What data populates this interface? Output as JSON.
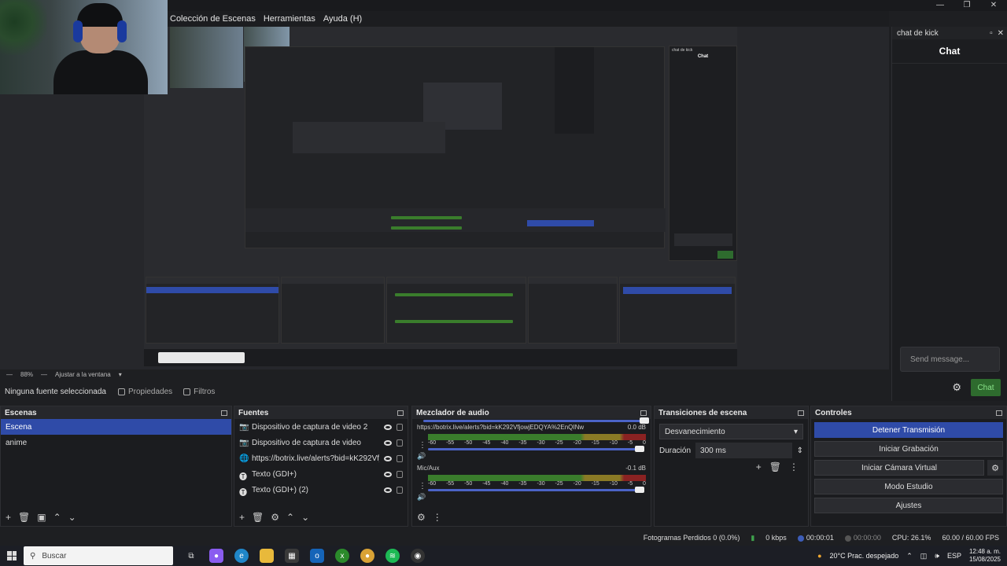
{
  "window": {
    "controls": [
      "—",
      "❐",
      "✕"
    ]
  },
  "menu": {
    "items": [
      "Colección de Escenas",
      "Herramientas",
      "Ayuda (H)"
    ]
  },
  "zoom": {
    "level": "88%",
    "fit": "Ajustar a la ventana"
  },
  "source_bar": {
    "selection": "Ninguna fuente seleccionada",
    "properties": "Propiedades",
    "filters": "Filtros"
  },
  "scenes": {
    "title": "Escenas",
    "items": [
      "Escena",
      "anime"
    ],
    "selected": 0
  },
  "sources": {
    "title": "Fuentes",
    "items": [
      {
        "name": "Dispositivo de captura de video 2",
        "icon": "camera-icon"
      },
      {
        "name": "Dispositivo de captura de video",
        "icon": "camera-icon"
      },
      {
        "name": "https://botrix.live/alerts?bid=kK292VfjowjEDQYA%2EnQINw",
        "icon": "globe-icon"
      },
      {
        "name": "Texto (GDI+)",
        "icon": "text-icon"
      },
      {
        "name": "Texto (GDI+) (2)",
        "icon": "text-icon"
      }
    ]
  },
  "mixer": {
    "title": "Mezclador de audio",
    "channels": [
      {
        "name": "https://botrix.live/alerts?bid=kK292VfjowjEDQYA%2EnQINw",
        "db": "0.0 dB"
      },
      {
        "name": "Mic/Aux",
        "db": "-0.1 dB"
      }
    ],
    "scale": [
      "-60",
      "-55",
      "-50",
      "-45",
      "-40",
      "-35",
      "-30",
      "-25",
      "-20",
      "-15",
      "-10",
      "-5",
      "0"
    ]
  },
  "transitions": {
    "title": "Transiciones de escena",
    "selected": "Desvanecimiento",
    "duration_label": "Duración",
    "duration_value": "300 ms"
  },
  "controls": {
    "title": "Controles",
    "stop_stream": "Detener Transmisión",
    "start_recording": "Iniciar Grabación",
    "virtual_cam": "Iniciar Cámara Virtual",
    "studio_mode": "Modo Estudio",
    "settings": "Ajustes"
  },
  "status": {
    "dropped": "Fotogramas Perdidos 0 (0.0%)",
    "bitrate": "0 kbps",
    "stream_time": "00:00:01",
    "rec_time": "00:00:00",
    "cpu": "CPU: 26.1%",
    "fps": "60.00 / 60.00 FPS"
  },
  "chat": {
    "dock_title": "chat de kick",
    "header": "Chat",
    "placeholder": "Send message...",
    "send": "Chat"
  },
  "taskbar": {
    "search": "Buscar",
    "weather": "20°C  Prac. despejado",
    "lang": "ESP",
    "time": "12:48 a. m.",
    "date": "15/08/2025"
  },
  "colors": {
    "accent": "#2f4ba8",
    "meter_green": "#3a7d2c",
    "meter_yellow": "#8a7a25",
    "meter_red": "#8a2222",
    "chat_green": "#2e6b2e"
  }
}
